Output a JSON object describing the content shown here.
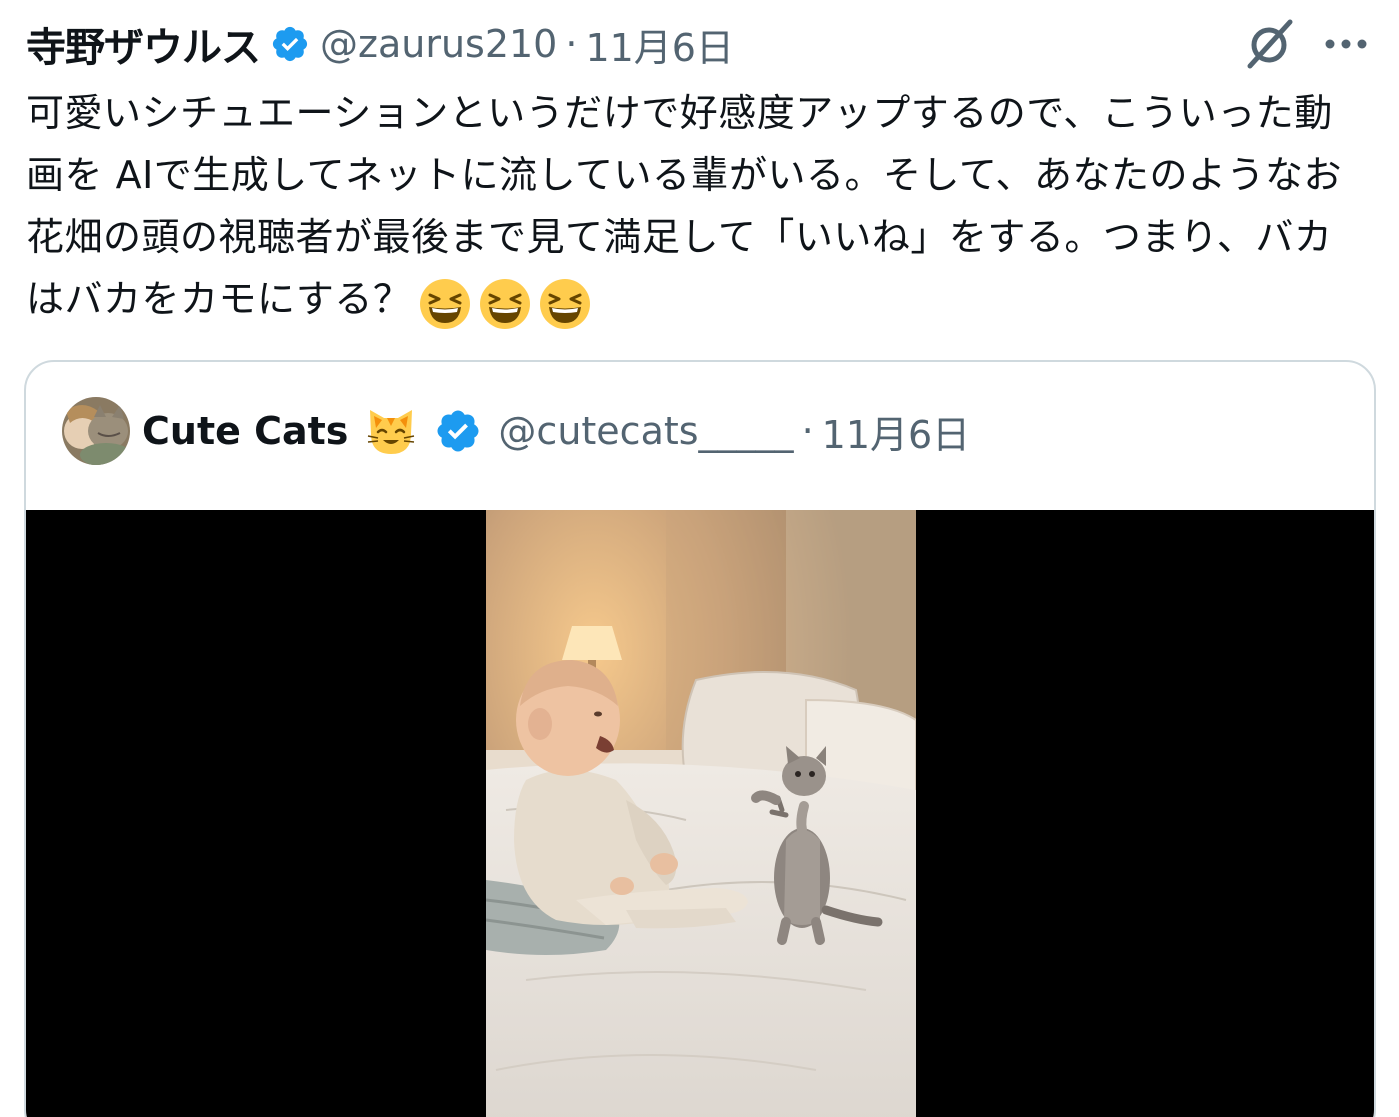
{
  "tweet": {
    "author": {
      "display_name": "寺野ザウルス",
      "handle": "@zaurus210",
      "verified": true
    },
    "separator": "·",
    "date": "11月6日",
    "icons": {
      "verified": "verified-badge-icon",
      "grok": "grok-icon",
      "more": "more-options-icon"
    },
    "body": "可愛いシチュエーションというだけで好感度アップするので、こういった動画を AIで生成してネットに流している輩がいる。そして、あなたのようなお花畑の頭の視聴者が最後まで見て満足して「いいね」をする。つまり、バカはバカをカモにする？",
    "emojis": [
      "laughing-emoji",
      "laughing-emoji",
      "laughing-emoji"
    ]
  },
  "quoted_tweet": {
    "author": {
      "display_name": "Cute Cats",
      "handle": "@cutecats_____",
      "verified": true,
      "name_emoji": "cat-face-emoji"
    },
    "separator": "·",
    "date": "11月6日",
    "media": {
      "type": "video",
      "scene": "baby-and-kitten-on-bed"
    }
  },
  "colors": {
    "text": "#0f1419",
    "secondary": "#536471",
    "verified": "#1d9bf0",
    "border": "#cfd9de",
    "video_bg": "#000000"
  }
}
